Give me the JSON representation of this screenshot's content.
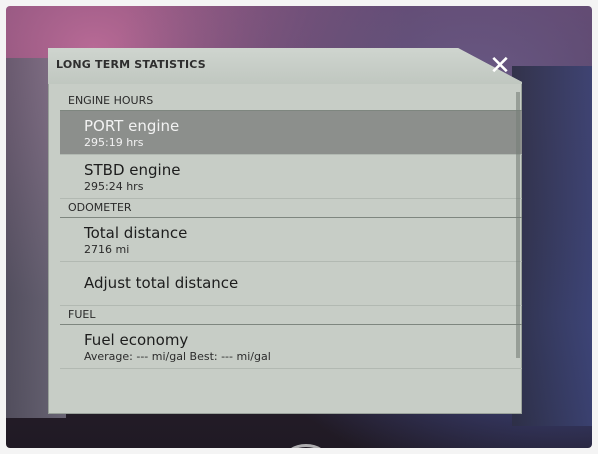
{
  "dialog": {
    "title": "LONG TERM STATISTICS",
    "close_icon": "close-icon"
  },
  "sections": [
    {
      "header": "ENGINE HOURS",
      "rows": [
        {
          "label": "PORT engine",
          "sub": "295:19 hrs",
          "selected": true
        },
        {
          "label": "STBD engine",
          "sub": "295:24 hrs",
          "selected": false
        }
      ]
    },
    {
      "header": "ODOMETER",
      "rows": [
        {
          "label": "Total distance",
          "sub": "2716 mi",
          "selected": false
        },
        {
          "label": "Adjust total distance",
          "sub": "",
          "selected": false
        }
      ]
    },
    {
      "header": "FUEL",
      "rows": [
        {
          "label": "Fuel economy",
          "sub": "Average: --- mi/gal Best: --- mi/gal",
          "selected": false
        }
      ]
    }
  ],
  "colors": {
    "selected_row": "#8c8f8c",
    "dialog_bg": "#c7cdc6"
  }
}
